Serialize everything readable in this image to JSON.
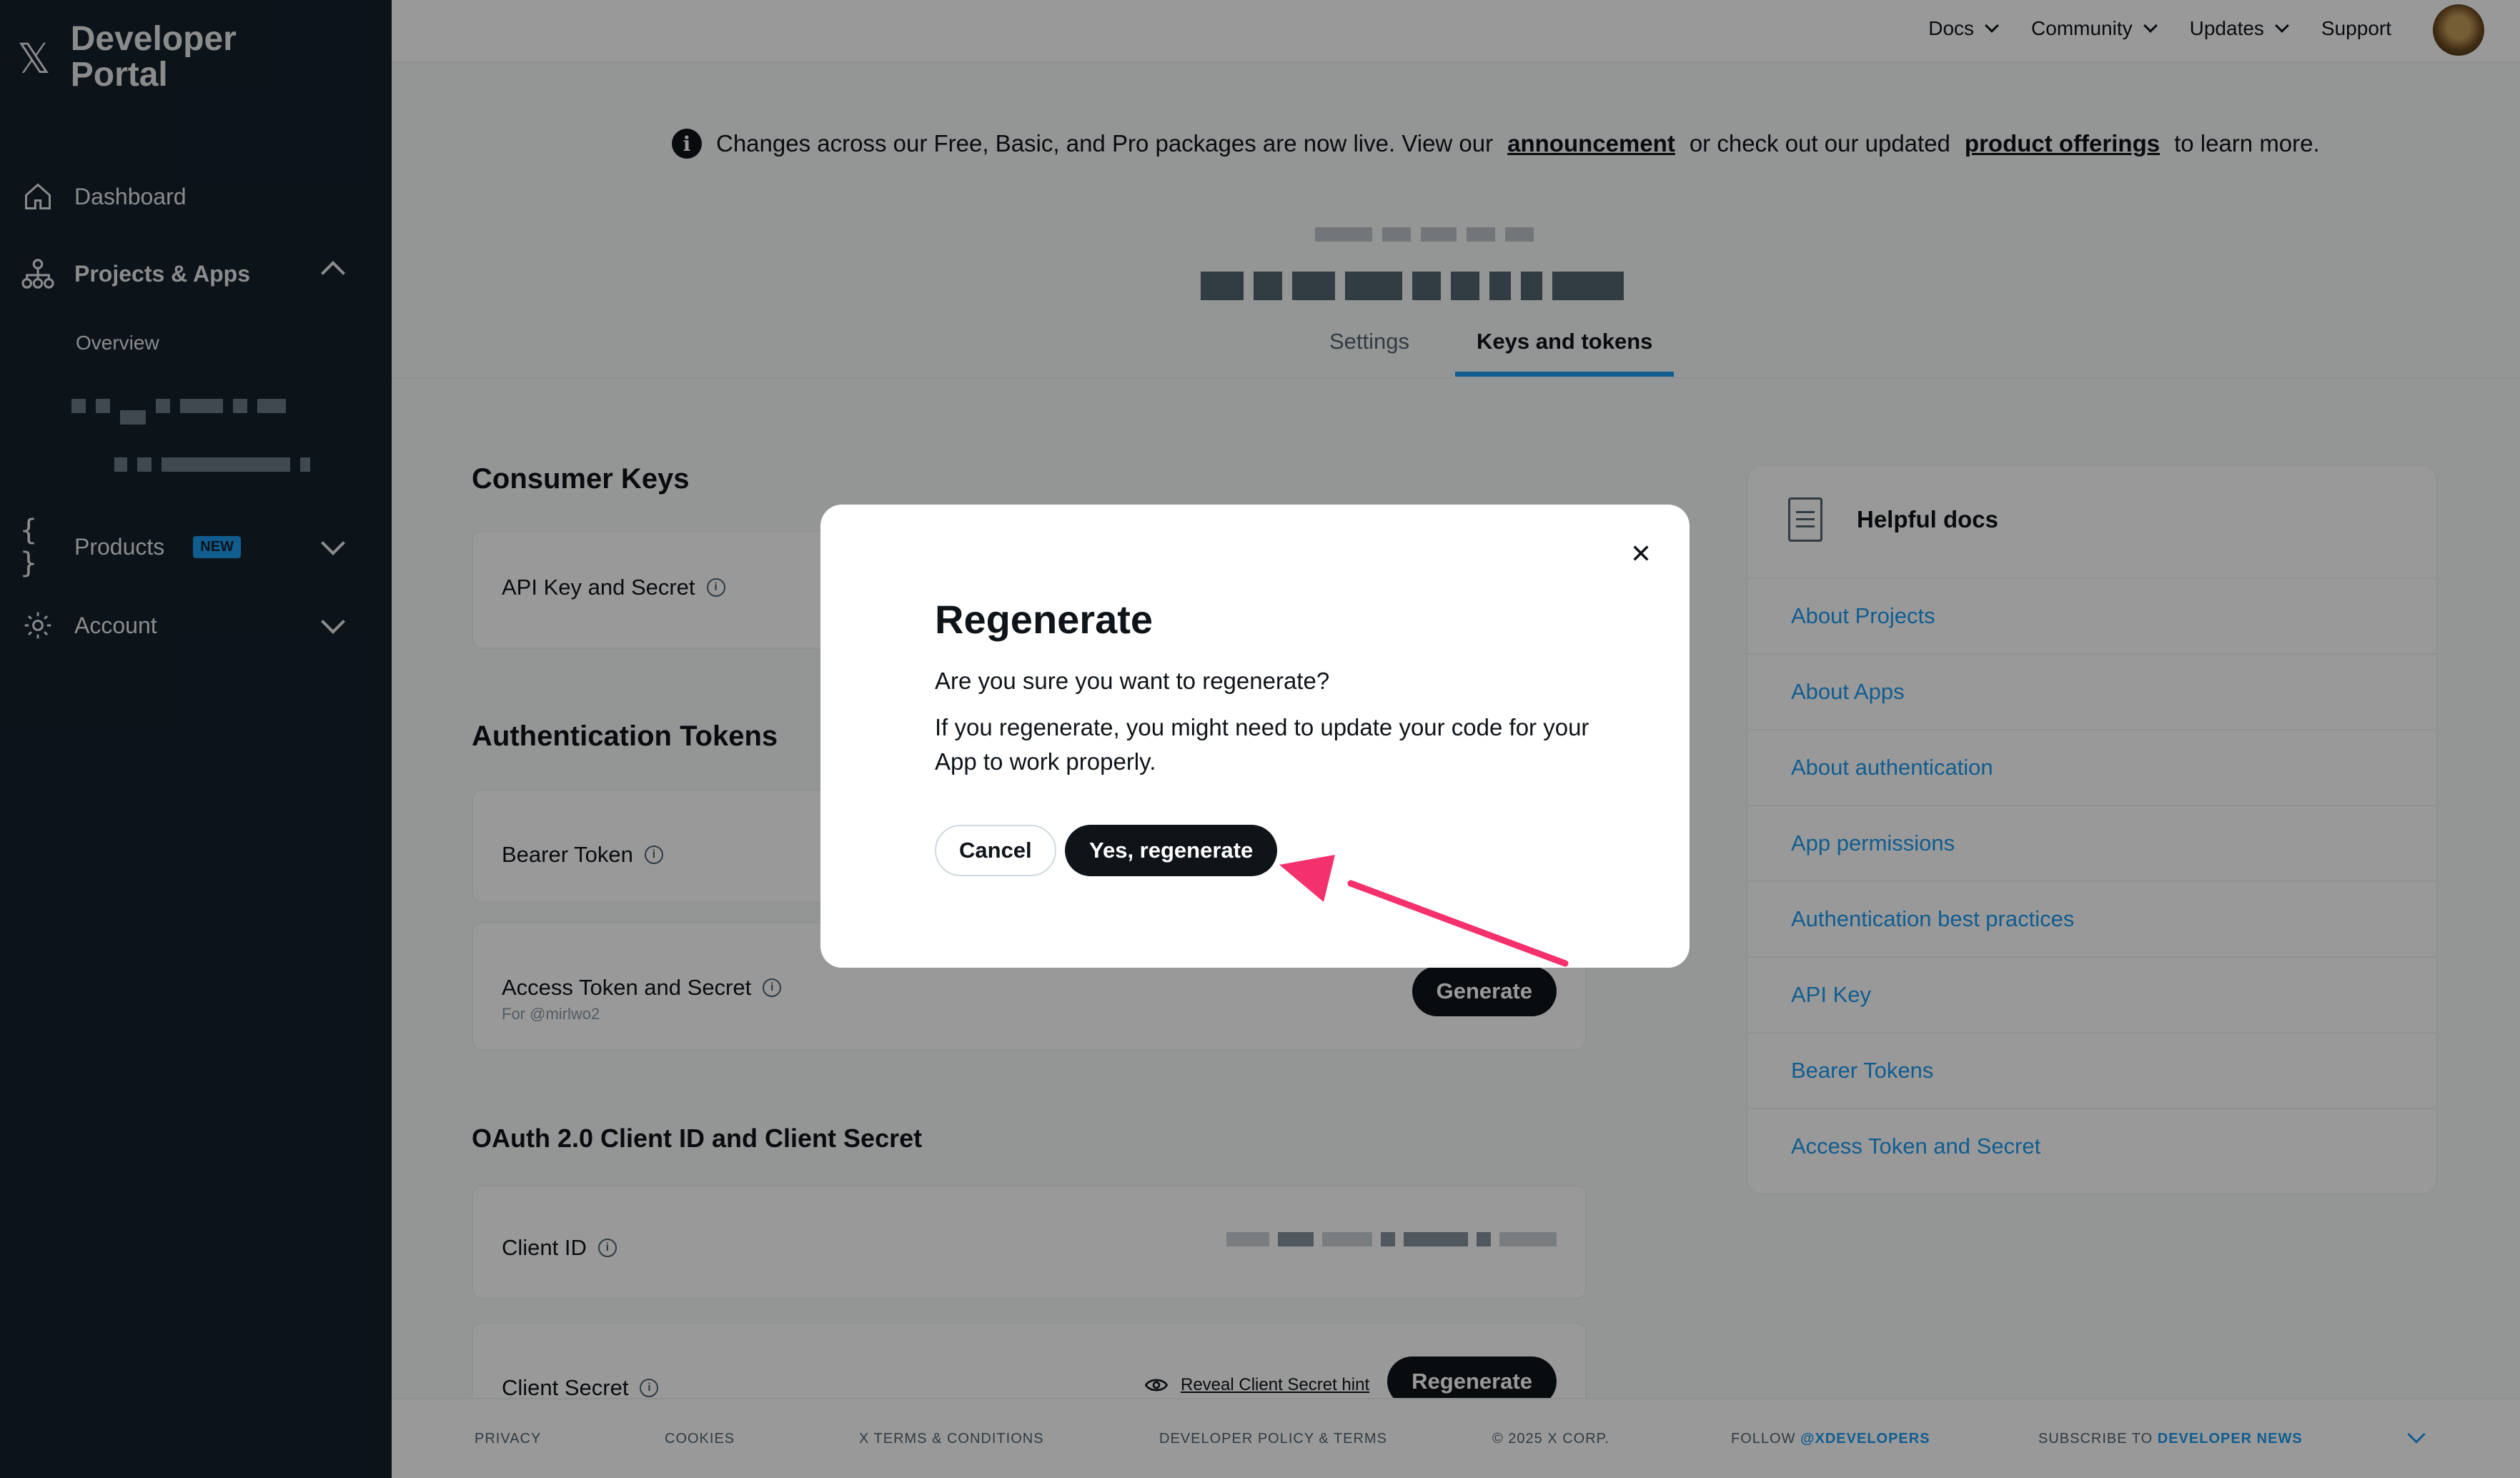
{
  "brand": {
    "title": "Developer Portal"
  },
  "sidebar": {
    "dashboard": "Dashboard",
    "projects_apps": "Projects & Apps",
    "overview": "Overview",
    "products": "Products",
    "new_badge": "NEW",
    "account": "Account"
  },
  "topnav": {
    "docs": "Docs",
    "community": "Community",
    "updates": "Updates",
    "support": "Support"
  },
  "banner": {
    "pre": "Changes across our Free, Basic, and Pro packages are now live. View our",
    "link1": "announcement",
    "mid": "or check out our updated",
    "link2": "product offerings",
    "post": "to learn more."
  },
  "tabs": {
    "settings": "Settings",
    "keys": "Keys and tokens"
  },
  "consumer_keys": {
    "title": "Consumer Keys",
    "api_key": "API Key and Secret"
  },
  "auth_tokens": {
    "title": "Authentication Tokens",
    "bearer": "Bearer Token",
    "access": "Access Token and Secret",
    "access_for": "For @mirlwo2",
    "generate": "Generate"
  },
  "oauth": {
    "title": "OAuth 2.0 Client ID and Client Secret",
    "client_id": "Client ID",
    "client_secret": "Client Secret",
    "reveal": "Reveal Client Secret hint",
    "regenerate": "Regenerate"
  },
  "docs": {
    "title": "Helpful docs",
    "items": [
      "About Projects",
      "About Apps",
      "About authentication",
      "App permissions",
      "Authentication best practices",
      "API Key",
      "Bearer Tokens",
      "Access Token and Secret"
    ]
  },
  "footer": {
    "privacy": "PRIVACY",
    "cookies": "COOKIES",
    "terms": "X TERMS & CONDITIONS",
    "policy": "DEVELOPER POLICY & TERMS",
    "copyright": "© 2025 X CORP.",
    "follow": "FOLLOW",
    "follow_handle": "@XDEVELOPERS",
    "subscribe": "SUBSCRIBE TO",
    "subscribe_link": "DEVELOPER NEWS"
  },
  "modal": {
    "title": "Regenerate",
    "question": "Are you sure you want to regenerate?",
    "body": "If you regenerate, you might need to update your code for your App to work properly.",
    "cancel": "Cancel",
    "confirm": "Yes, regenerate"
  },
  "colors": {
    "accent": "#1d9bf0",
    "sidebar_bg": "#15202b",
    "annotation_arrow": "#f4306d"
  }
}
